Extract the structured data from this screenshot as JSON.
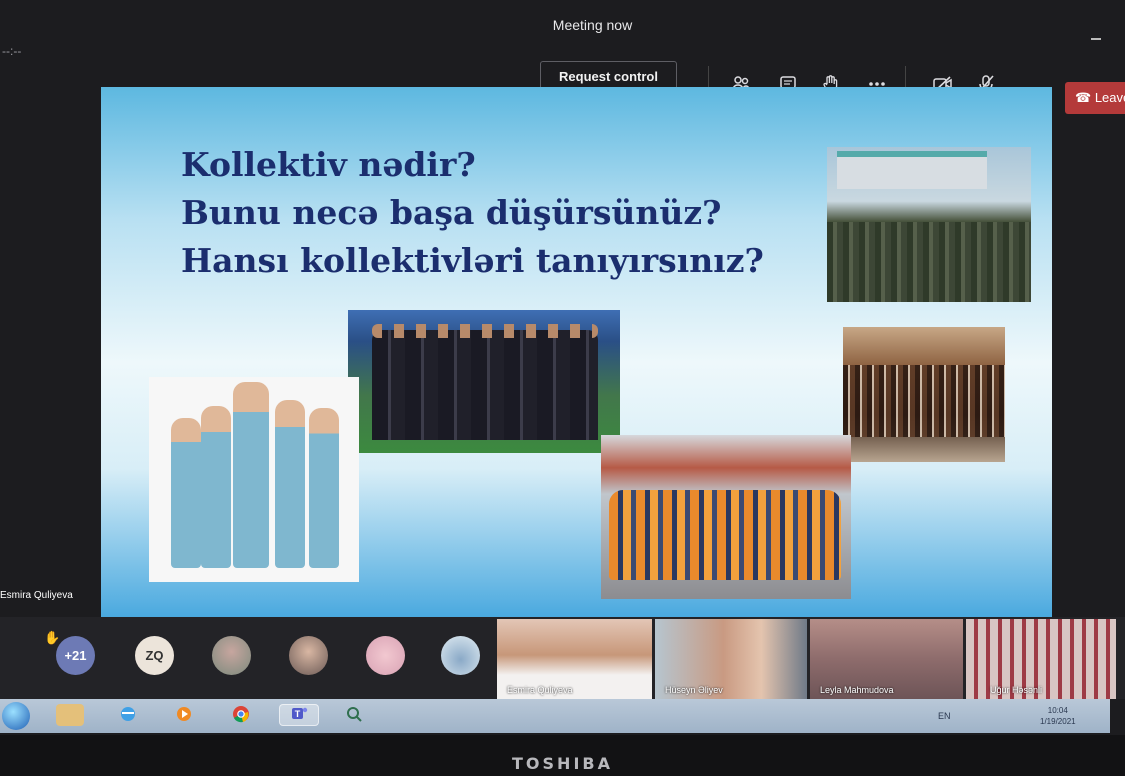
{
  "window": {
    "title": "Meeting now",
    "timer": "--:--"
  },
  "toolbar": {
    "request_control_label": "Request control",
    "leave_label": "Leave",
    "icons": [
      "participants-icon",
      "chat-icon",
      "raise-hand-icon",
      "more-options-icon",
      "camera-off-icon",
      "mic-off-icon",
      "leave-phone-icon"
    ]
  },
  "slide": {
    "questions": [
      "Kollektiv nədir?",
      "Bunu necə başa düşürsünüz?",
      "Hansı kollektivləri tanıyırsınız?"
    ],
    "images": [
      "army-parade-photo",
      "football-team-photo",
      "medical-staff-photo",
      "orchestra-photo",
      "construction-workers-photo"
    ],
    "accent_color": "#1b2e6e"
  },
  "presenter_name": "Esmira Quliyeva",
  "participants": {
    "overflow_count": "+21",
    "avatar_initials": "ZQ"
  },
  "video_tiles": [
    {
      "name": "Esmira Quliyeva"
    },
    {
      "name": "Hüseyn Əliyev"
    },
    {
      "name": "Leyla Mahmudova"
    },
    {
      "name": "Uğur Həsənli"
    }
  ],
  "taskbar": {
    "language": "EN",
    "time": "10:04",
    "date": "1/19/2021"
  },
  "device_brand": "TOSHIBA"
}
